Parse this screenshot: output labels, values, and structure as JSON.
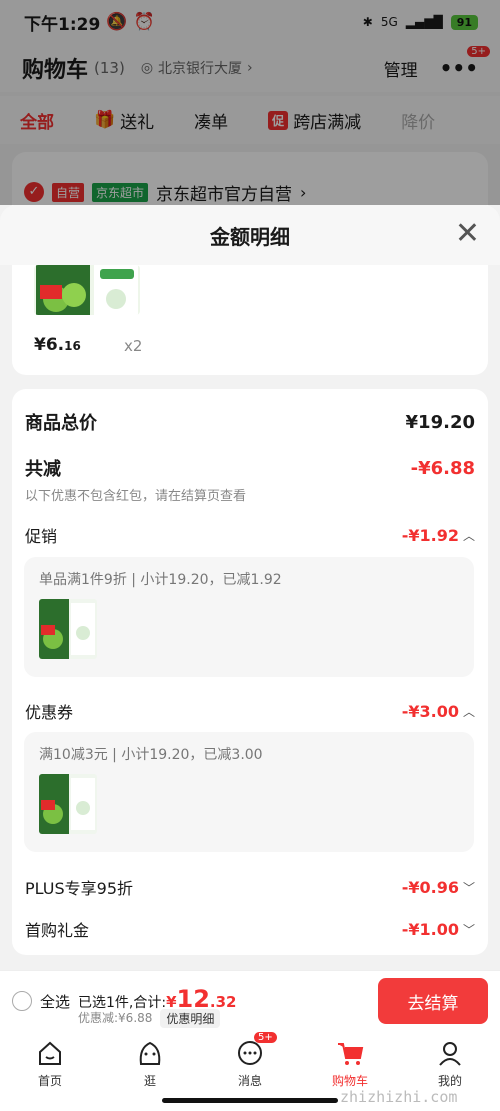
{
  "status": {
    "time": "下午1:29",
    "network": "5G",
    "battery": "91"
  },
  "header": {
    "title": "购物车",
    "count": "(13)",
    "location": "北京银行大厦",
    "manage": "管理",
    "more_badge": "5+"
  },
  "tabs": [
    {
      "label": "全部"
    },
    {
      "label": "送礼"
    },
    {
      "label": "凑单"
    },
    {
      "label": "跨店满减",
      "tag": "促"
    },
    {
      "label": "降价"
    }
  ],
  "store": {
    "badge_self": "自营",
    "badge_market": "京东超市",
    "name": "京东超市官方自营"
  },
  "sheet": {
    "title": "金额明细",
    "product": {
      "price_main": "¥6.",
      "price_cents": "16",
      "qty": "x2"
    },
    "goods_total_label": "商品总价",
    "goods_total_value": "¥19.20",
    "reduce_label": "共减",
    "reduce_value": "-¥6.88",
    "reduce_note": "以下优惠不包含红包，请在结算页查看",
    "promo_label": "促销",
    "promo_value": "-¥1.92",
    "promo_text": "单品满1件9折 | 小计19.20，已减1.92",
    "coupon_label": "优惠券",
    "coupon_value": "-¥3.00",
    "coupon_text": "满10减3元 | 小计19.20，已减3.00",
    "plus_label": "PLUS专享95折",
    "plus_value": "-¥0.96",
    "first_label": "首购礼金",
    "first_value": "-¥1.00"
  },
  "action_bar": {
    "select_all": "全选",
    "selected_text": "已选1件,合计:",
    "total_symbol": "¥",
    "total_int": "12",
    "total_dec": ".32",
    "discount_text": "优惠减:¥6.88",
    "detail_chip": "优惠明细",
    "checkout": "去结算"
  },
  "nav": [
    {
      "label": "首页"
    },
    {
      "label": "逛"
    },
    {
      "label": "消息",
      "badge": "5+"
    },
    {
      "label": "购物车"
    },
    {
      "label": "我的"
    }
  ],
  "watermark": "zhizhizhi.com",
  "colors": {
    "accent": "#f23030",
    "checkout": "#f23b3b",
    "green_badge": "#1aa34a"
  }
}
